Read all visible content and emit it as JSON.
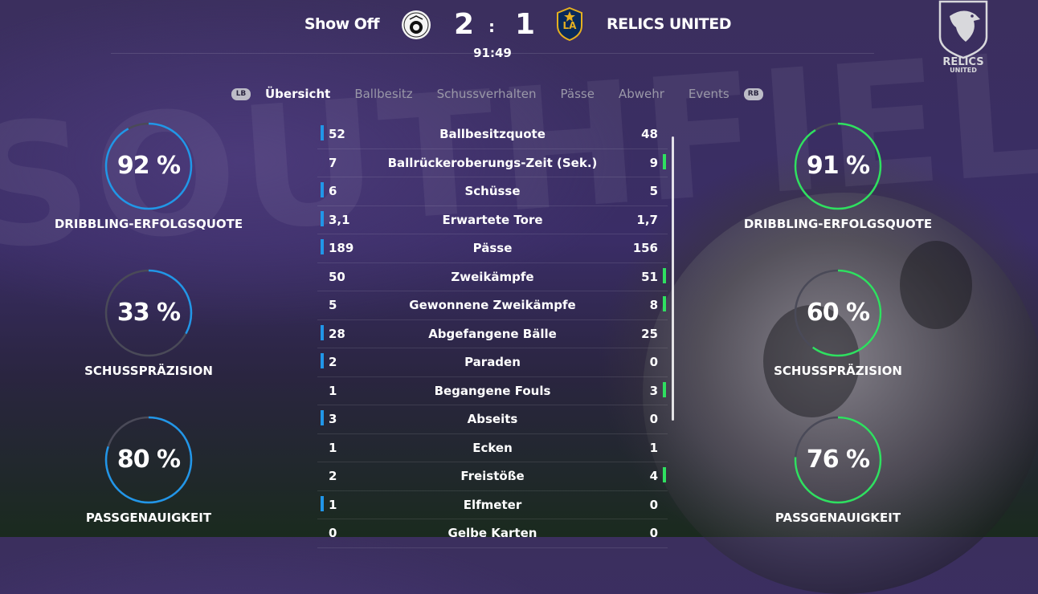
{
  "header": {
    "home_team": "Show Off",
    "away_team": "RELICS UNITED",
    "home_score": "2",
    "separator": ":",
    "away_score": "1",
    "clock": "91:49",
    "away_crest_text": "LA",
    "logo_text_top": "RELICS",
    "logo_text_bottom": "UNITED"
  },
  "tabs": {
    "lb": "LB",
    "rb": "RB",
    "items": [
      "Übersicht",
      "Ballbesitz",
      "Schussverhalten",
      "Pässe",
      "Abwehr",
      "Events"
    ]
  },
  "home_gauges": [
    {
      "value": "92 %",
      "fraction": 0.92,
      "label": "DRIBBLING-ERFOLGSQUOTE"
    },
    {
      "value": "33 %",
      "fraction": 0.33,
      "label": "SCHUSSPRÄZISION"
    },
    {
      "value": "80 %",
      "fraction": 0.8,
      "label": "PASSGENAUIGKEIT"
    }
  ],
  "away_gauges": [
    {
      "value": "91 %",
      "fraction": 0.91,
      "label": "DRIBBLING-ERFOLGSQUOTE"
    },
    {
      "value": "60 %",
      "fraction": 0.6,
      "label": "SCHUSSPRÄZISION"
    },
    {
      "value": "76 %",
      "fraction": 0.76,
      "label": "PASSGENAUIGKEIT"
    }
  ],
  "stats": [
    {
      "home": "52",
      "label": "Ballbesitzquote",
      "away": "48",
      "lead": "home"
    },
    {
      "home": "7",
      "label": "Ballrückeroberungs-Zeit (Sek.)",
      "away": "9",
      "lead": "away"
    },
    {
      "home": "6",
      "label": "Schüsse",
      "away": "5",
      "lead": "home"
    },
    {
      "home": "3,1",
      "label": "Erwartete Tore",
      "away": "1,7",
      "lead": "home"
    },
    {
      "home": "189",
      "label": "Pässe",
      "away": "156",
      "lead": "home"
    },
    {
      "home": "50",
      "label": "Zweikämpfe",
      "away": "51",
      "lead": "away"
    },
    {
      "home": "5",
      "label": "Gewonnene Zweikämpfe",
      "away": "8",
      "lead": "away"
    },
    {
      "home": "28",
      "label": "Abgefangene Bälle",
      "away": "25",
      "lead": "home"
    },
    {
      "home": "2",
      "label": "Paraden",
      "away": "0",
      "lead": "home"
    },
    {
      "home": "1",
      "label": "Begangene Fouls",
      "away": "3",
      "lead": "away"
    },
    {
      "home": "3",
      "label": "Abseits",
      "away": "0",
      "lead": "home"
    },
    {
      "home": "1",
      "label": "Ecken",
      "away": "1",
      "lead": "none"
    },
    {
      "home": "2",
      "label": "Freistöße",
      "away": "4",
      "lead": "away"
    },
    {
      "home": "1",
      "label": "Elfmeter",
      "away": "0",
      "lead": "home"
    },
    {
      "home": "0",
      "label": "Gelbe Karten",
      "away": "0",
      "lead": "none"
    }
  ],
  "colors": {
    "home_accent": "#2196e8",
    "away_accent": "#2fe060",
    "track": "#4a4a58"
  }
}
